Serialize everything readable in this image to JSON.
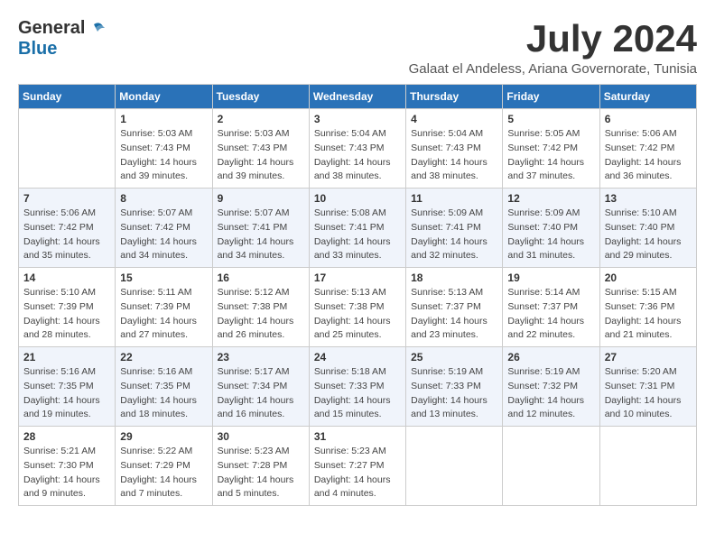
{
  "header": {
    "logo_general": "General",
    "logo_blue": "Blue",
    "month_title": "July 2024",
    "location": "Galaat el Andeless, Ariana Governorate, Tunisia"
  },
  "weekdays": [
    "Sunday",
    "Monday",
    "Tuesday",
    "Wednesday",
    "Thursday",
    "Friday",
    "Saturday"
  ],
  "weeks": [
    [
      {
        "day": "",
        "info": ""
      },
      {
        "day": "1",
        "info": "Sunrise: 5:03 AM\nSunset: 7:43 PM\nDaylight: 14 hours\nand 39 minutes."
      },
      {
        "day": "2",
        "info": "Sunrise: 5:03 AM\nSunset: 7:43 PM\nDaylight: 14 hours\nand 39 minutes."
      },
      {
        "day": "3",
        "info": "Sunrise: 5:04 AM\nSunset: 7:43 PM\nDaylight: 14 hours\nand 38 minutes."
      },
      {
        "day": "4",
        "info": "Sunrise: 5:04 AM\nSunset: 7:43 PM\nDaylight: 14 hours\nand 38 minutes."
      },
      {
        "day": "5",
        "info": "Sunrise: 5:05 AM\nSunset: 7:42 PM\nDaylight: 14 hours\nand 37 minutes."
      },
      {
        "day": "6",
        "info": "Sunrise: 5:06 AM\nSunset: 7:42 PM\nDaylight: 14 hours\nand 36 minutes."
      }
    ],
    [
      {
        "day": "7",
        "info": "Sunrise: 5:06 AM\nSunset: 7:42 PM\nDaylight: 14 hours\nand 35 minutes."
      },
      {
        "day": "8",
        "info": "Sunrise: 5:07 AM\nSunset: 7:42 PM\nDaylight: 14 hours\nand 34 minutes."
      },
      {
        "day": "9",
        "info": "Sunrise: 5:07 AM\nSunset: 7:41 PM\nDaylight: 14 hours\nand 34 minutes."
      },
      {
        "day": "10",
        "info": "Sunrise: 5:08 AM\nSunset: 7:41 PM\nDaylight: 14 hours\nand 33 minutes."
      },
      {
        "day": "11",
        "info": "Sunrise: 5:09 AM\nSunset: 7:41 PM\nDaylight: 14 hours\nand 32 minutes."
      },
      {
        "day": "12",
        "info": "Sunrise: 5:09 AM\nSunset: 7:40 PM\nDaylight: 14 hours\nand 31 minutes."
      },
      {
        "day": "13",
        "info": "Sunrise: 5:10 AM\nSunset: 7:40 PM\nDaylight: 14 hours\nand 29 minutes."
      }
    ],
    [
      {
        "day": "14",
        "info": "Sunrise: 5:10 AM\nSunset: 7:39 PM\nDaylight: 14 hours\nand 28 minutes."
      },
      {
        "day": "15",
        "info": "Sunrise: 5:11 AM\nSunset: 7:39 PM\nDaylight: 14 hours\nand 27 minutes."
      },
      {
        "day": "16",
        "info": "Sunrise: 5:12 AM\nSunset: 7:38 PM\nDaylight: 14 hours\nand 26 minutes."
      },
      {
        "day": "17",
        "info": "Sunrise: 5:13 AM\nSunset: 7:38 PM\nDaylight: 14 hours\nand 25 minutes."
      },
      {
        "day": "18",
        "info": "Sunrise: 5:13 AM\nSunset: 7:37 PM\nDaylight: 14 hours\nand 23 minutes."
      },
      {
        "day": "19",
        "info": "Sunrise: 5:14 AM\nSunset: 7:37 PM\nDaylight: 14 hours\nand 22 minutes."
      },
      {
        "day": "20",
        "info": "Sunrise: 5:15 AM\nSunset: 7:36 PM\nDaylight: 14 hours\nand 21 minutes."
      }
    ],
    [
      {
        "day": "21",
        "info": "Sunrise: 5:16 AM\nSunset: 7:35 PM\nDaylight: 14 hours\nand 19 minutes."
      },
      {
        "day": "22",
        "info": "Sunrise: 5:16 AM\nSunset: 7:35 PM\nDaylight: 14 hours\nand 18 minutes."
      },
      {
        "day": "23",
        "info": "Sunrise: 5:17 AM\nSunset: 7:34 PM\nDaylight: 14 hours\nand 16 minutes."
      },
      {
        "day": "24",
        "info": "Sunrise: 5:18 AM\nSunset: 7:33 PM\nDaylight: 14 hours\nand 15 minutes."
      },
      {
        "day": "25",
        "info": "Sunrise: 5:19 AM\nSunset: 7:33 PM\nDaylight: 14 hours\nand 13 minutes."
      },
      {
        "day": "26",
        "info": "Sunrise: 5:19 AM\nSunset: 7:32 PM\nDaylight: 14 hours\nand 12 minutes."
      },
      {
        "day": "27",
        "info": "Sunrise: 5:20 AM\nSunset: 7:31 PM\nDaylight: 14 hours\nand 10 minutes."
      }
    ],
    [
      {
        "day": "28",
        "info": "Sunrise: 5:21 AM\nSunset: 7:30 PM\nDaylight: 14 hours\nand 9 minutes."
      },
      {
        "day": "29",
        "info": "Sunrise: 5:22 AM\nSunset: 7:29 PM\nDaylight: 14 hours\nand 7 minutes."
      },
      {
        "day": "30",
        "info": "Sunrise: 5:23 AM\nSunset: 7:28 PM\nDaylight: 14 hours\nand 5 minutes."
      },
      {
        "day": "31",
        "info": "Sunrise: 5:23 AM\nSunset: 7:27 PM\nDaylight: 14 hours\nand 4 minutes."
      },
      {
        "day": "",
        "info": ""
      },
      {
        "day": "",
        "info": ""
      },
      {
        "day": "",
        "info": ""
      }
    ]
  ]
}
